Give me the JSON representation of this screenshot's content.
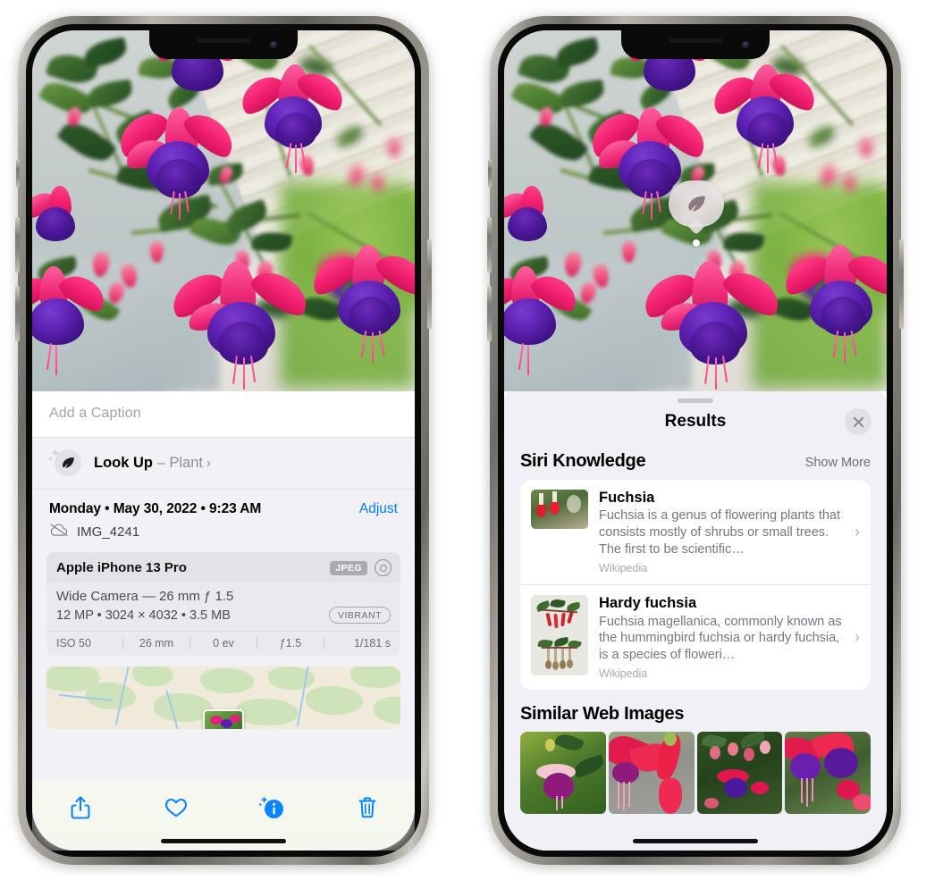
{
  "device": {
    "model_shown_in_metadata": "Apple iPhone 13 Pro",
    "frame_buttons": [
      "silent-switch",
      "volume-up",
      "volume-down",
      "side-power"
    ]
  },
  "left_phone": {
    "screen_name": "photo-detail-info",
    "photo": {
      "subject": "fuchsia flowers",
      "alt": "Close-up of pink and purple fuchsia blossoms hanging from a plant"
    },
    "caption_field": {
      "placeholder": "Add a Caption",
      "value": ""
    },
    "look_up_row": {
      "icon": "leaf-icon",
      "label": "Look Up",
      "dash": " – ",
      "subject": "Plant",
      "chevron": "›"
    },
    "date_row": {
      "date": "Monday • May 30, 2022 • 9:23 AM",
      "adjust_label": "Adjust"
    },
    "file_row": {
      "icon": "icloud-slash-icon",
      "filename": "IMG_4241"
    },
    "camera_card": {
      "model": "Apple iPhone 13 Pro",
      "format_badge": "JPEG",
      "lens_icon": "lens-icon",
      "lens_line": "Wide Camera — 26 mm ƒ 1.5",
      "size_line": "12 MP • 3024 × 4032 • 3.5 MB",
      "style_badge": "VIBRANT",
      "exif": [
        "ISO 50",
        "26 mm",
        "0 ev",
        "ƒ1.5",
        "1/181 s"
      ]
    },
    "map_card": {
      "name": "location-map",
      "has_photo_pin": true
    },
    "toolbar": [
      {
        "name": "share-button",
        "icon": "share-icon"
      },
      {
        "name": "favorite-button",
        "icon": "heart-icon"
      },
      {
        "name": "info-button",
        "icon": "info-sparkle-icon",
        "active": true
      },
      {
        "name": "delete-button",
        "icon": "trash-icon"
      }
    ],
    "accent_color": "#007aff"
  },
  "right_phone": {
    "screen_name": "visual-look-up-results",
    "photo": {
      "subject": "fuchsia flowers",
      "alt": "Close-up of pink and purple fuchsia blossoms hanging from a plant"
    },
    "visual_lookup_badge": {
      "icon": "leaf-icon",
      "name": "visual-look-up-badge"
    },
    "sheet": {
      "grabber": true,
      "title": "Results",
      "close_icon": "close-icon"
    },
    "siri_knowledge": {
      "section_title": "Siri Knowledge",
      "show_more_label": "Show More",
      "items": [
        {
          "title": "Fuchsia",
          "description": "Fuchsia is a genus of flowering plants that consists mostly of shrubs or small trees. The first to be scientific…",
          "source": "Wikipedia",
          "thumb_alt": "Red fuchsia flowers among foliage",
          "chevron": "›"
        },
        {
          "title": "Hardy fuchsia",
          "description": "Fuchsia magellanica, commonly known as the hummingbird fuchsia or hardy fuchsia, is a species of floweri…",
          "source": "Wikipedia",
          "thumb_alt": "Herbarium specimen of Fuchsia magellanica",
          "chevron": "›"
        }
      ]
    },
    "similar_web_images": {
      "section_title": "Similar Web Images",
      "tiles": [
        {
          "alt": "Magenta fuchsia flower with green leaves"
        },
        {
          "alt": "Close-up of red fuchsia blossoms"
        },
        {
          "alt": "Fuchsia bush with buds and blooms"
        },
        {
          "alt": "Purple and red double fuchsia flowers"
        }
      ]
    }
  }
}
